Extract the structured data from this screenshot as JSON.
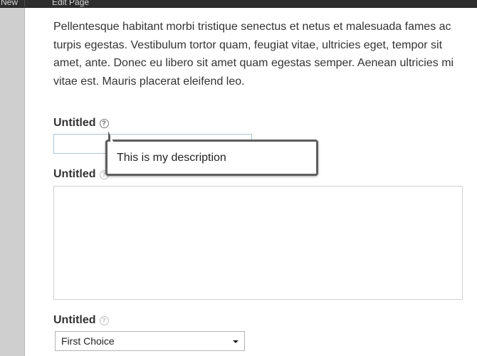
{
  "topbar": {
    "new_label": "New",
    "edit_label": "Edit Page"
  },
  "intro_text": "Pellentesque habitant morbi tristique senectus et netus et malesuada fames ac turpis egestas. Vestibulum tortor quam, feugiat vitae, ultricies eget, tempor sit amet, ante. Donec eu libero sit amet quam egestas semper. Aenean ultricies mi vitae est. Mauris placerat eleifend leo.",
  "fields": [
    {
      "label": "Untitled",
      "type": "text",
      "value": ""
    },
    {
      "label": "Untitled",
      "type": "textarea",
      "value": ""
    },
    {
      "label": "Untitled",
      "type": "select",
      "selected": "First Choice"
    }
  ],
  "help_icon_glyph": "?",
  "tooltip": {
    "text": "This is my description"
  },
  "colors": {
    "topbar": "#2e2e2e",
    "sidebar": "#cfcfcf",
    "tooltip_border": "#5e5e5e",
    "input_focus_border": "#a9c6d6"
  }
}
